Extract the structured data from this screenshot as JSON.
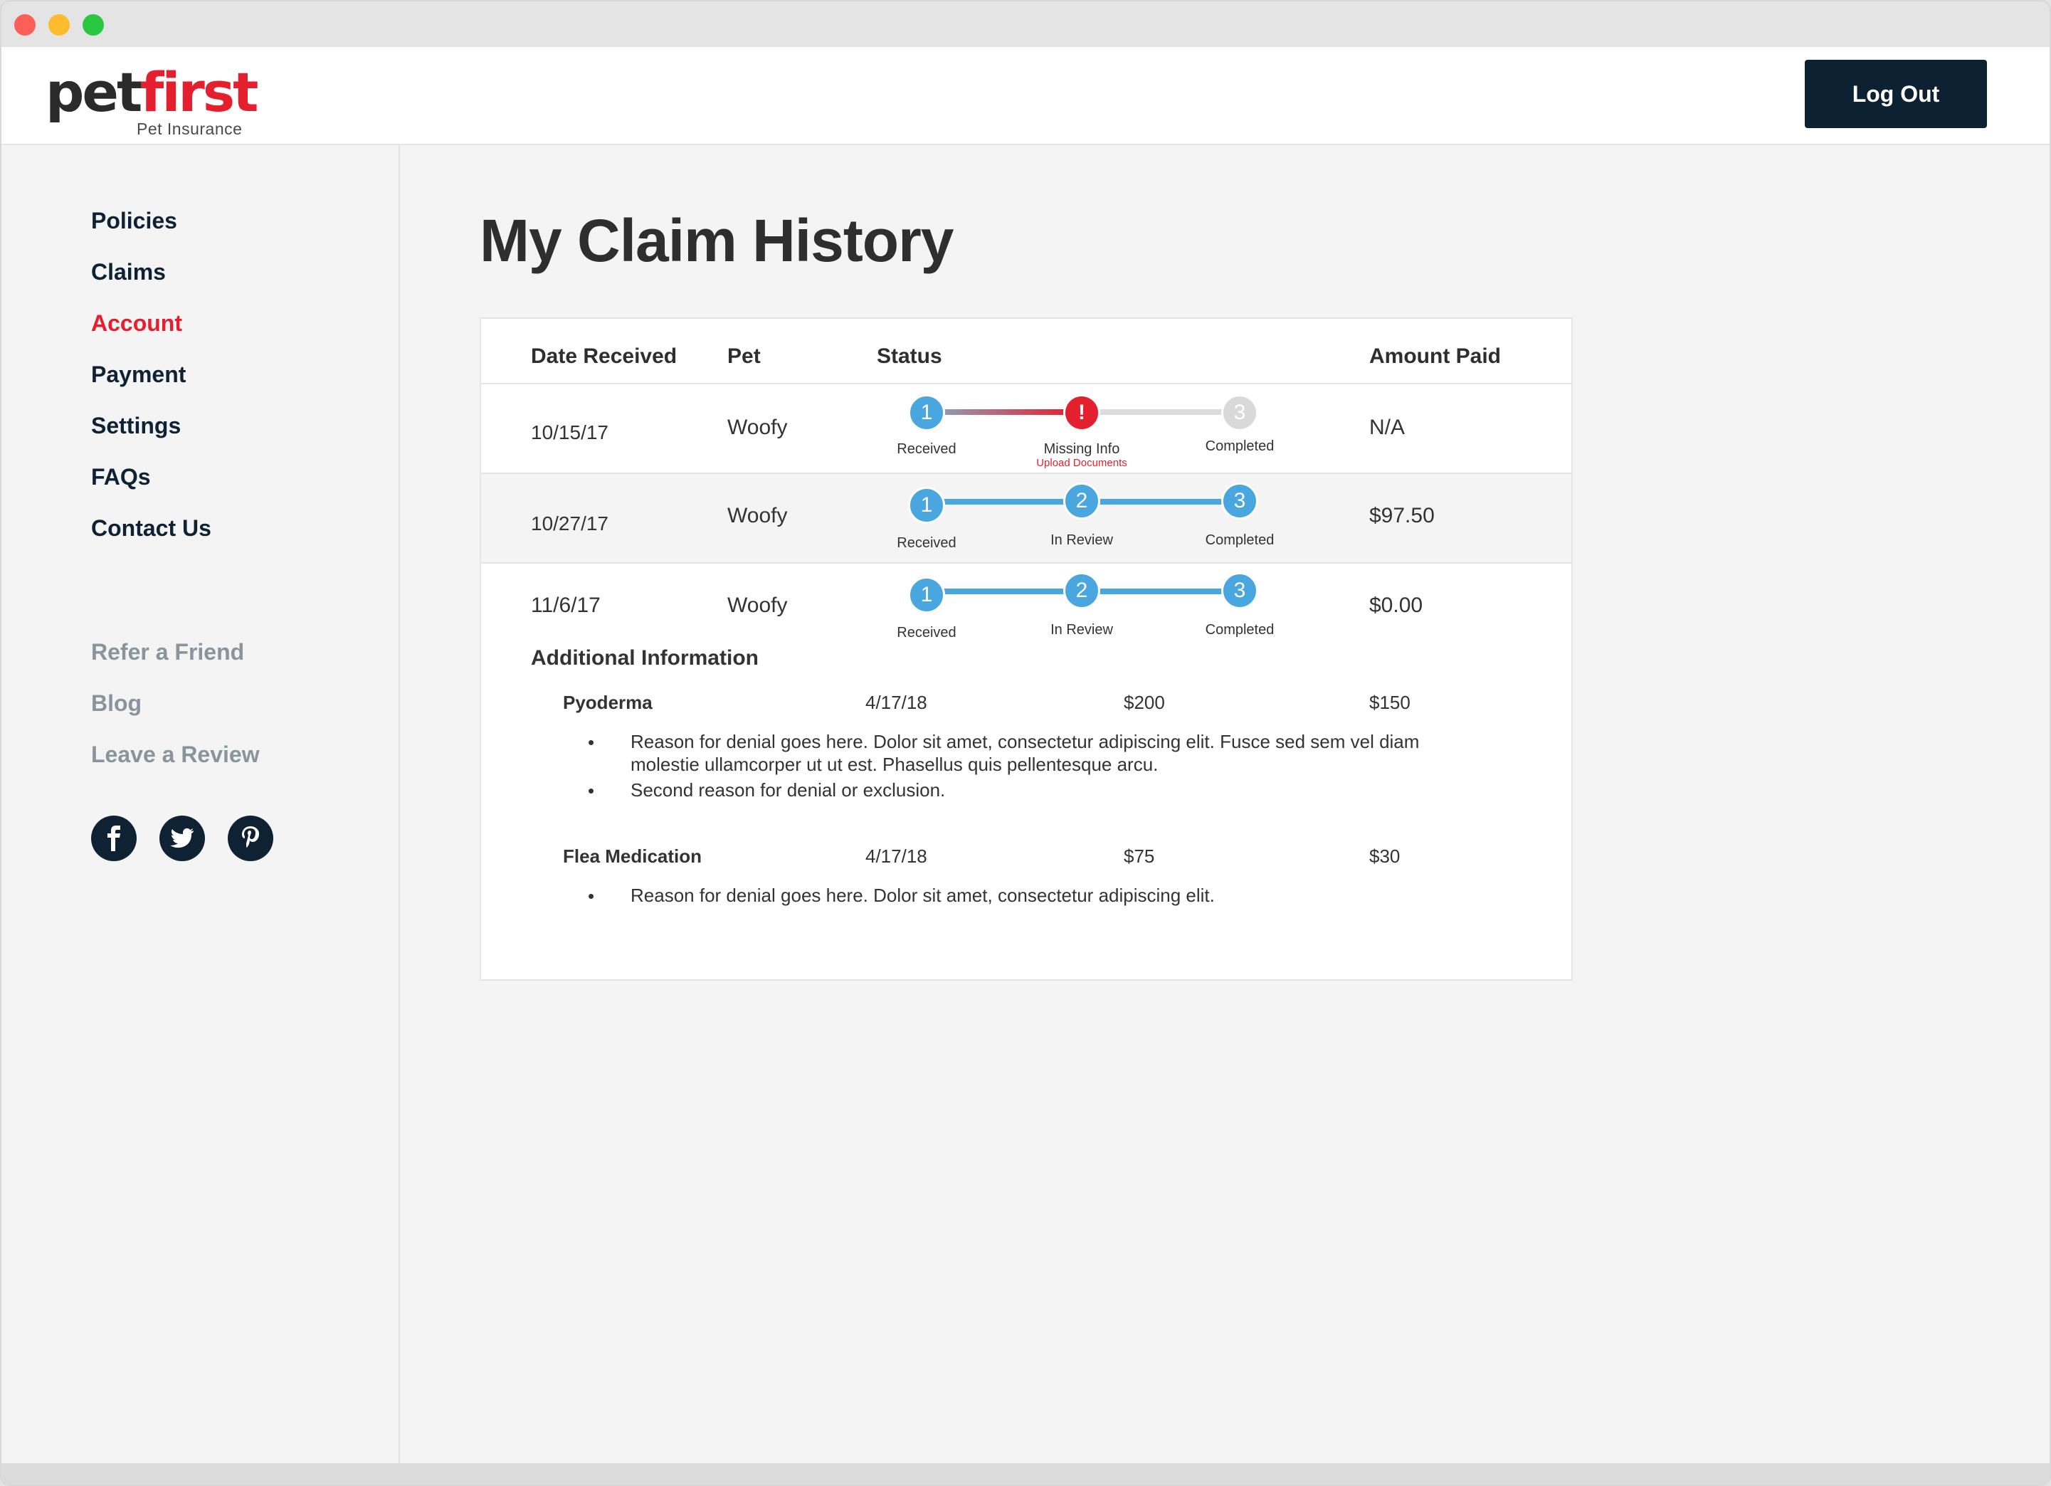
{
  "brand": {
    "name_part1": "pet",
    "name_part2": "first",
    "subtitle": "Pet Insurance",
    "primary_color": "#0c2132",
    "accent_color": "#e5202e"
  },
  "header": {
    "logout_label": "Log Out"
  },
  "sidebar": {
    "primary": [
      "Policies",
      "Claims",
      "Account",
      "Payment",
      "Settings",
      "FAQs",
      "Contact Us"
    ],
    "active": "Account",
    "secondary": [
      "Refer a Friend",
      "Blog",
      "Leave a Review"
    ],
    "social_icons": [
      "facebook-icon",
      "twitter-icon",
      "pinterest-icon"
    ]
  },
  "page": {
    "title": "My Claim History"
  },
  "table": {
    "headers": {
      "date": "Date Received",
      "pet": "Pet",
      "status": "Status",
      "amount": "Amount Paid"
    },
    "rows": [
      {
        "date": "10/15/17",
        "pet": "Woofy",
        "amount": "N/A",
        "steps": [
          {
            "num": "1",
            "label": "Received",
            "state": "done"
          },
          {
            "num": "!",
            "label": "Missing Info",
            "sub": "Upload Documents",
            "state": "error"
          },
          {
            "num": "3",
            "label": "Completed",
            "state": "pending"
          }
        ]
      },
      {
        "date": "10/27/17",
        "pet": "Woofy",
        "amount": "$97.50",
        "steps": [
          {
            "num": "1",
            "label": "Received",
            "state": "done"
          },
          {
            "num": "2",
            "label": "In Review",
            "state": "done"
          },
          {
            "num": "3",
            "label": "Completed",
            "state": "done"
          }
        ]
      },
      {
        "date": "11/6/17",
        "pet": "Woofy",
        "amount": "$0.00",
        "steps": [
          {
            "num": "1",
            "label": "Received",
            "state": "done"
          },
          {
            "num": "2",
            "label": "In Review",
            "state": "done"
          },
          {
            "num": "3",
            "label": "Completed",
            "state": "done"
          }
        ]
      }
    ],
    "additional": {
      "title": "Additional Information",
      "items": [
        {
          "name": "Pyoderma",
          "date": "4/17/18",
          "billed": "$200",
          "paid": "$150",
          "reasons": [
            "Reason for denial goes here. Dolor sit amet, consectetur adipiscing elit. Fusce sed sem vel diam molestie ullamcorper ut ut est. Phasellus quis pellentesque arcu.",
            "Second reason for denial or exclusion."
          ]
        },
        {
          "name": "Flea Medication",
          "date": "4/17/18",
          "billed": "$75",
          "paid": "$30",
          "reasons": [
            "Reason for denial goes here. Dolor sit amet, consectetur adipiscing elit."
          ]
        }
      ]
    }
  }
}
